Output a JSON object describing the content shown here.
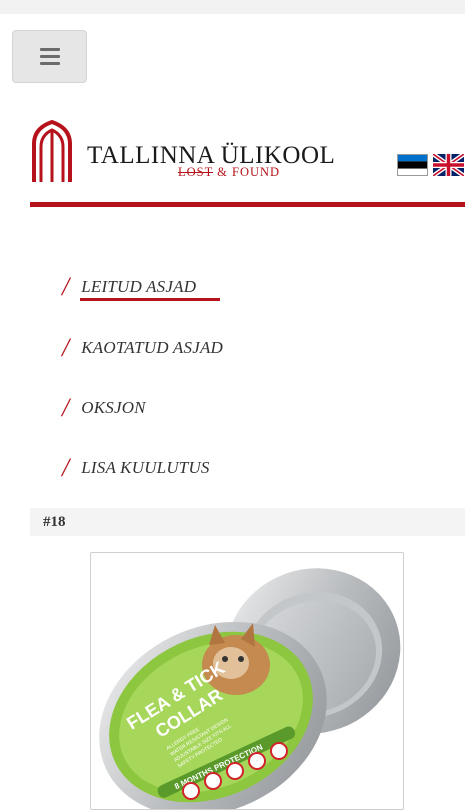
{
  "header": {
    "menu_icon": "hamburger-icon"
  },
  "logo": {
    "title": "TALLINNA ÜLIKOOL",
    "sub_strike": "LOST",
    "sub_rest": " & FOUND",
    "brand_color": "#b5121b"
  },
  "languages": [
    {
      "code": "et",
      "icon": "estonian-flag-icon"
    },
    {
      "code": "en",
      "icon": "uk-flag-icon"
    }
  ],
  "nav": {
    "items": [
      {
        "label": "LEITUD ASJAD",
        "active": true
      },
      {
        "label": "KAOTATUD ASJAD",
        "active": false
      },
      {
        "label": "OKSJON",
        "active": false
      },
      {
        "label": "LISA KUULUTUS",
        "active": false
      }
    ]
  },
  "item": {
    "number": "#18",
    "image": {
      "title_line1": "FLEA & TICK",
      "title_line2": "COLLAR",
      "features": [
        "ALLERGY FREE",
        "WATER RESISTANT DESIGN",
        "ADJUSTABLE SIZE FITS ALL",
        "SAFETY PROTECTED"
      ],
      "band": "8 MONTHS PROTECTION"
    }
  }
}
